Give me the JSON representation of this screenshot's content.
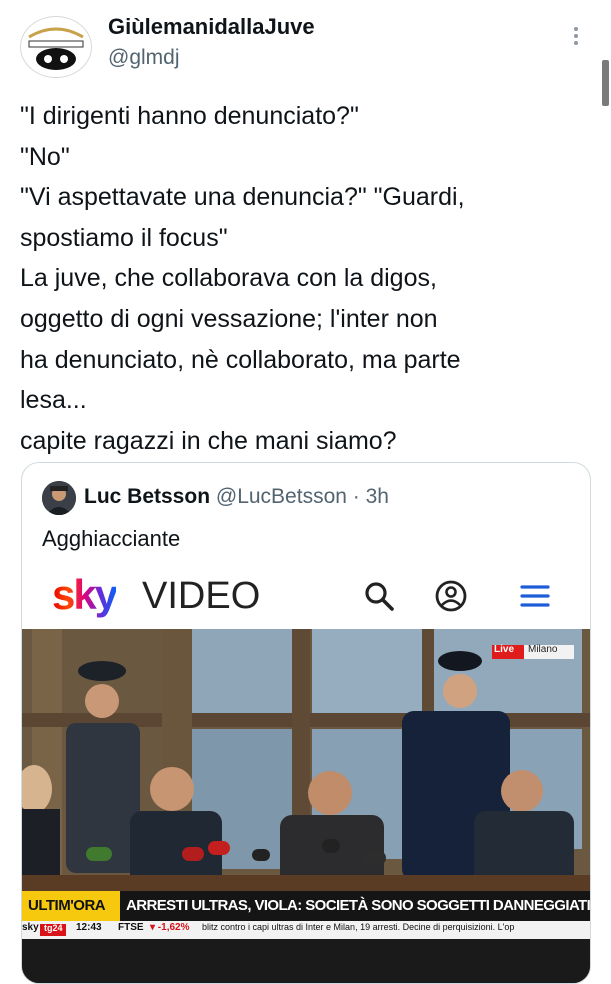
{
  "account": {
    "name": "GiùlemanidallaJuve",
    "handle": "@glmdj"
  },
  "tweet_lines": [
    "\"I dirigenti hanno denunciato?\"",
    "\"No\"",
    "\"Vi aspettavate una denuncia?\" \"Guardi,",
    "spostiamo il focus\"",
    "La juve, che collaborava con la digos,",
    "oggetto di ogni vessazione; l'inter non",
    "ha denunciato, nè collaborato, ma parte",
    "lesa...",
    "capite ragazzi in che mani siamo?"
  ],
  "quote": {
    "name": "Luc Betsson",
    "handle": "@LucBetsson",
    "sep": " · ",
    "time": "3h",
    "text": "Agghiacciante"
  },
  "sky": {
    "logo": "sky",
    "section": "VIDEO"
  },
  "video": {
    "live_badge": "Live",
    "live_location": "Milano",
    "ticker_tag": "ULTIM'ORA",
    "ticker_headline": "ARRESTI ULTRAS, VIOLA: SOCIETÀ SONO SOGGETTI DANNEGGIATI",
    "bottom_brand": "sky",
    "bottom_channel": "tg24",
    "clock": "12:43",
    "ftse_label": "FTSE",
    "ftse_value": "▾ -1,62%",
    "crawl": "blitz contro i capi ultras di Inter e Milan, 19 arresti. Decine di perquisizioni. L'op"
  },
  "colors": {
    "accent_blue": "#1d9bf0",
    "ticker_yellow": "#f6c90e",
    "ticker_black": "#151515",
    "sky_red": "#e60000"
  },
  "icons": [
    "more-icon",
    "search-icon",
    "account-icon",
    "menu-icon"
  ]
}
